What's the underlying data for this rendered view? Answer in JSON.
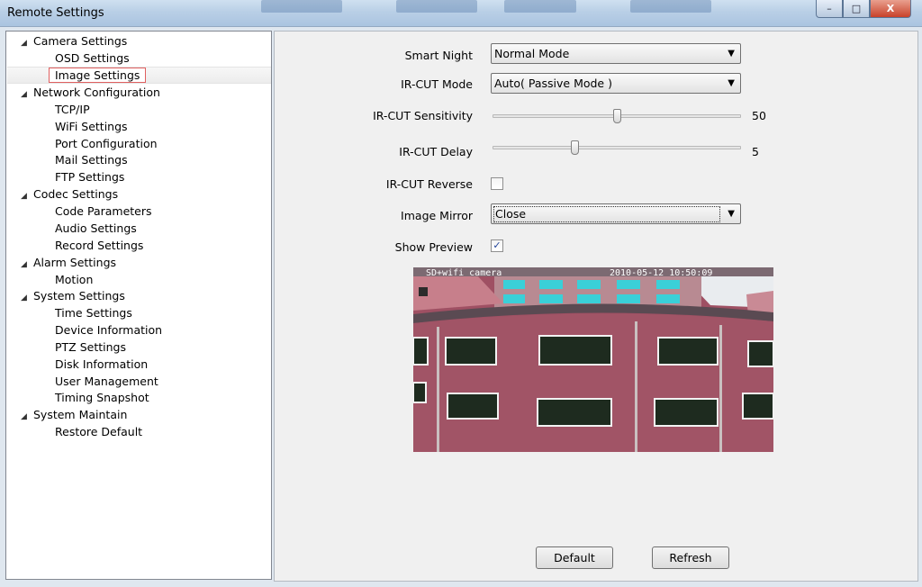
{
  "window": {
    "title": "Remote Settings",
    "min_glyph": "–",
    "max_glyph": "□",
    "close_glyph": "X"
  },
  "tree": {
    "categories": [
      {
        "label": "Camera Settings",
        "children": [
          "OSD Settings",
          "Image Settings"
        ]
      },
      {
        "label": "Network Configuration",
        "children": [
          "TCP/IP",
          "WiFi Settings",
          "Port Configuration",
          "Mail Settings",
          "FTP Settings"
        ]
      },
      {
        "label": "Codec Settings",
        "children": [
          "Code Parameters",
          "Audio Settings",
          "Record Settings"
        ]
      },
      {
        "label": "Alarm Settings",
        "children": [
          "Motion"
        ]
      },
      {
        "label": "System Settings",
        "children": [
          "Time Settings",
          "Device Information",
          "PTZ Settings",
          "Disk Information",
          "User Management",
          "Timing Snapshot"
        ]
      },
      {
        "label": "System Maintain",
        "children": [
          "Restore Default"
        ]
      }
    ],
    "selected": "Image Settings",
    "expand_glyph": "◢"
  },
  "form": {
    "smart_night": {
      "label": "Smart Night",
      "value": "Normal Mode"
    },
    "ircut_mode": {
      "label": "IR-CUT Mode",
      "value": "Auto( Passive Mode )"
    },
    "ircut_sensitivity": {
      "label": "IR-CUT Sensitivity",
      "value": "50",
      "fraction": 0.5
    },
    "ircut_delay": {
      "label": "IR-CUT Delay",
      "value": "5",
      "fraction": 0.33
    },
    "ircut_reverse": {
      "label": "IR-CUT Reverse",
      "checked": false
    },
    "image_mirror": {
      "label": "Image Mirror",
      "value": "Close"
    },
    "show_preview": {
      "label": "Show Preview",
      "checked": true,
      "check_glyph": "✓"
    }
  },
  "preview": {
    "osd_name": "SD+wifi camera",
    "osd_time": "2010-05-12 10:50:09"
  },
  "buttons": {
    "default": "Default",
    "refresh": "Refresh"
  },
  "colors": {
    "selection_border": "#e06060",
    "title_gradient": "#b9cfe6",
    "wall": "#9a4e5f"
  }
}
